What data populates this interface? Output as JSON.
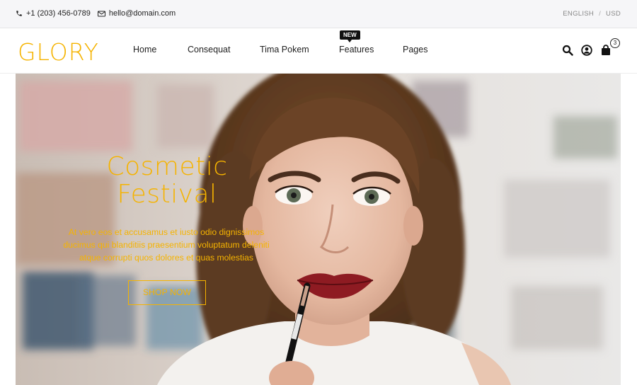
{
  "topbar": {
    "phone": "+1 (203) 456-0789",
    "email": "hello@domain.com",
    "language": "ENGLISH",
    "separator": "/",
    "currency": "USD"
  },
  "header": {
    "logo": "GLORY",
    "nav": [
      {
        "label": "Home"
      },
      {
        "label": "Consequat"
      },
      {
        "label": "Tima Pokem"
      },
      {
        "label": "Features",
        "badge": "NEW"
      },
      {
        "label": "Pages"
      }
    ],
    "icons": [
      "search-icon",
      "user-icon",
      "shopping-bag-icon"
    ],
    "cart_count": "3"
  },
  "hero": {
    "title_line1": "Cosmetic",
    "title_line2": "Festival",
    "text": "At vero eos et accusamus et iusto odio dignissimos ducimus qui blanditiis praesentium voluptatum deleniti atque corrupti quos dolores et quas molestias",
    "button": "SHOP NOW"
  },
  "colors": {
    "accent": "#f5b300",
    "topbar_bg": "#f6f6f8",
    "text": "#222222"
  }
}
